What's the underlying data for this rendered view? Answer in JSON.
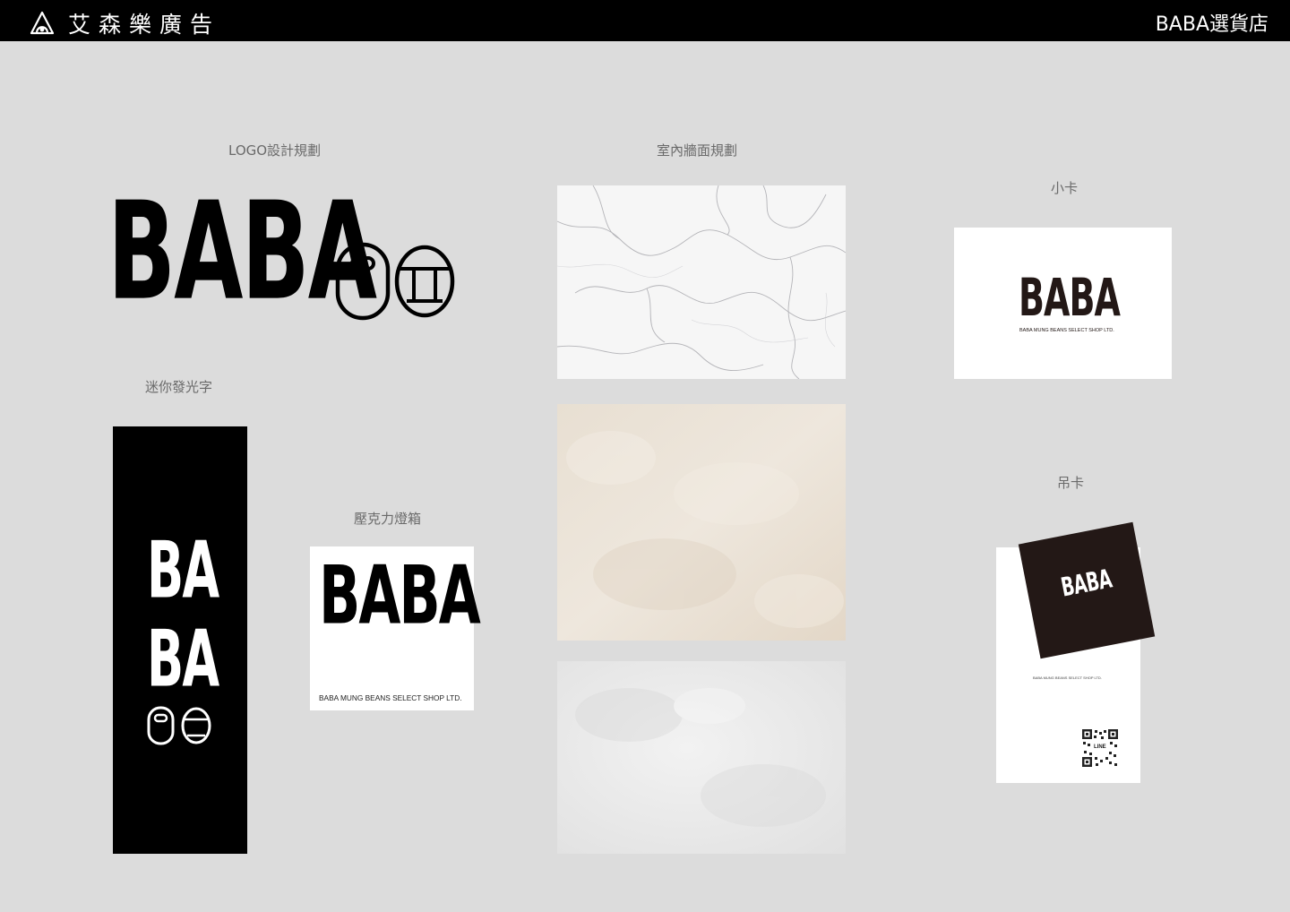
{
  "header": {
    "company": "艾森樂廣告",
    "project": "BABA選貨店"
  },
  "sections": {
    "logo": "LOGO設計規劃",
    "mini_sign": "迷你發光字",
    "acrylic": "壓克力燈箱",
    "wall": "室內牆面規劃",
    "card": "小卡",
    "hang_tag": "吊卡"
  },
  "brand": {
    "wordmark": "BABA",
    "tagline": "BABA MUNG BEANS SELECT SHOP LTD.",
    "mini_line1": "BA",
    "mini_line2": "BA",
    "qr_label": "LINE"
  },
  "colors": {
    "background": "#dcdcdc",
    "black": "#000000",
    "tag_brown": "#231816",
    "white": "#ffffff"
  }
}
